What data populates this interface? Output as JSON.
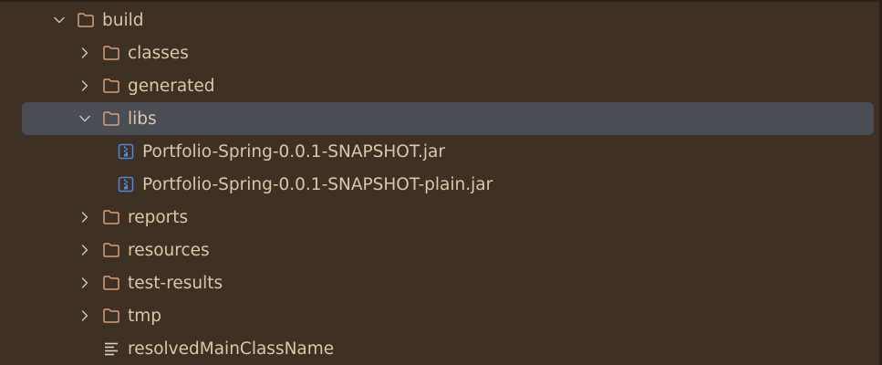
{
  "tree": {
    "build": {
      "label": "build",
      "expanded": true
    },
    "children": [
      {
        "label": "classes",
        "type": "folder",
        "expanded": false
      },
      {
        "label": "generated",
        "type": "folder",
        "expanded": false
      },
      {
        "label": "libs",
        "type": "folder",
        "expanded": true,
        "selected": true
      },
      {
        "label": "reports",
        "type": "folder",
        "expanded": false
      },
      {
        "label": "resources",
        "type": "folder",
        "expanded": false
      },
      {
        "label": "test-results",
        "type": "folder",
        "expanded": false
      },
      {
        "label": "tmp",
        "type": "folder",
        "expanded": false
      },
      {
        "label": "resolvedMainClassName",
        "type": "text-file"
      }
    ],
    "libs_children": [
      {
        "label": "Portfolio-Spring-0.0.1-SNAPSHOT.jar",
        "type": "jar"
      },
      {
        "label": "Portfolio-Spring-0.0.1-SNAPSHOT-plain.jar",
        "type": "jar"
      }
    ]
  },
  "colors": {
    "background": "#3e3022",
    "selection": "#4a4d53",
    "text": "#dcc6aa",
    "folder_icon": "#d8a07a",
    "jar_icon": "#4f86e0",
    "chevron": "#c9c2b8"
  }
}
